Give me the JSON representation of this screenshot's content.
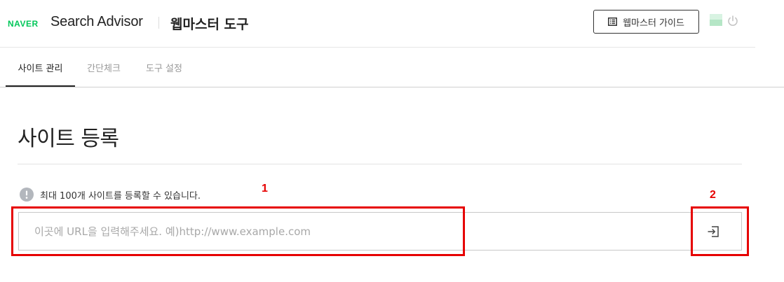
{
  "header": {
    "naver_logo": "NAVER",
    "app_title": "Search Advisor",
    "tool_title": "웹마스터 도구",
    "guide_button_label": "웹마스터 가이드",
    "brand_color": "#03c75a"
  },
  "tabs": [
    {
      "label": "사이트 관리",
      "active": true
    },
    {
      "label": "간단체크",
      "active": false
    },
    {
      "label": "도구 설정",
      "active": false
    }
  ],
  "main": {
    "page_title": "사이트 등록",
    "notice_text": "최대 100개 사이트를 등록할 수 있습니다.",
    "url_input": {
      "value": "",
      "placeholder": "이곳에 URL을 입력해주세요. 예)http://www.example.com"
    },
    "submit_icon": "login-arrow-icon"
  },
  "annotations": [
    {
      "label": "1",
      "color": "#e60000"
    },
    {
      "label": "2",
      "color": "#e60000"
    }
  ]
}
